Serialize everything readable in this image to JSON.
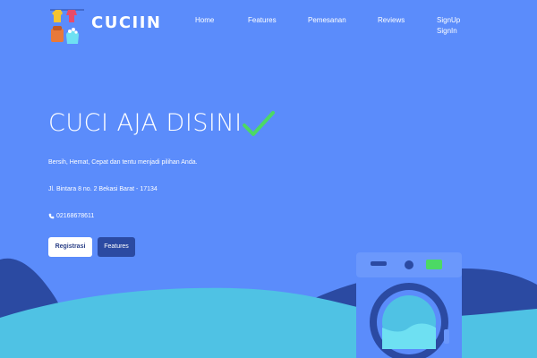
{
  "brand": {
    "name": "CUCIIN"
  },
  "nav": {
    "items": [
      "Home",
      "Features",
      "Pemesanan",
      "Reviews"
    ],
    "signup": "SignUp",
    "signin": "SignIn"
  },
  "hero": {
    "title": "CUCI AJA DISINI",
    "tagline": "Bersih, Hemat, Cepat dan tentu menjadi pilihan Anda.",
    "address": "Jl. Bintara 8 no. 2 Bekasi Barat - 17134",
    "phone": "02168678611",
    "buttons": {
      "register": "Registrasi",
      "features": "Features"
    }
  },
  "colors": {
    "background": "#5b8cfb",
    "wave_dark": "#2b4aa2",
    "wave_light": "#4fc2e4",
    "check": "#4cd964",
    "washer_body": "#5b8cfb",
    "washer_dark": "#2b4aa2"
  },
  "icons": {
    "logo": "laundry-basket-icon",
    "check": "checkmark-icon",
    "phone": "phone-icon",
    "washer": "washing-machine-icon"
  }
}
